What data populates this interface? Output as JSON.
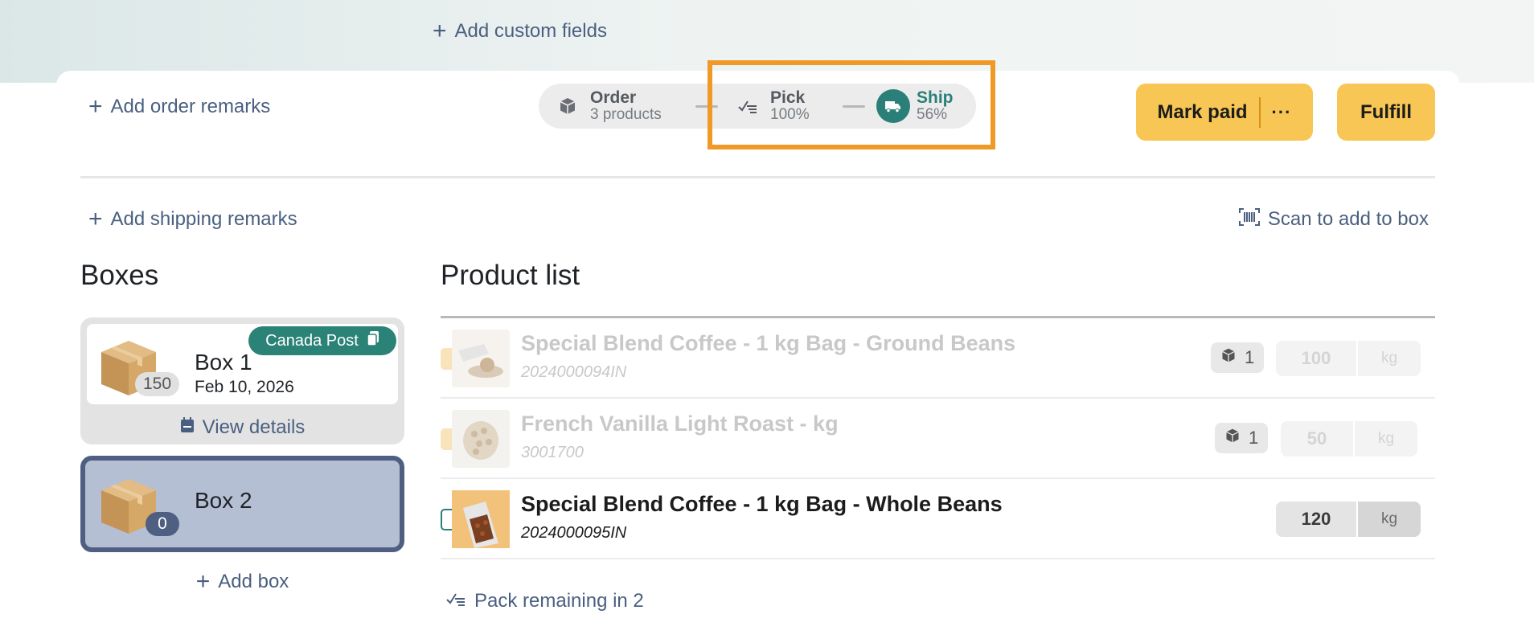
{
  "header": {
    "add_custom_fields": "Add custom fields",
    "add_order_remarks": "Add order remarks"
  },
  "progress": {
    "order": {
      "label": "Order",
      "sub": "3 products"
    },
    "pick": {
      "label": "Pick",
      "sub": "100%"
    },
    "ship": {
      "label": "Ship",
      "sub": "56%"
    }
  },
  "actions": {
    "mark_paid": "Mark paid",
    "more": "···",
    "fulfill": "Fulfill"
  },
  "shipping": {
    "add_shipping_remarks": "Add shipping remarks",
    "scan_to_add": "Scan to add to box"
  },
  "boxes": {
    "heading": "Boxes",
    "items": [
      {
        "title": "Box 1",
        "count": "150",
        "date": "Feb 10, 2026",
        "carrier": "Canada Post",
        "view_details": "View details"
      },
      {
        "title": "Box 2",
        "count": "0"
      }
    ],
    "add_box": "Add box"
  },
  "products": {
    "heading": "Product list",
    "items": [
      {
        "name": "Special Blend Coffee - 1 kg Bag - Ground Beans",
        "sku": "2024000094IN",
        "box_count": "1",
        "qty": "100",
        "unit": "kg",
        "status": "done"
      },
      {
        "name": "French Vanilla Light Roast - kg",
        "sku": "3001700",
        "box_count": "1",
        "qty": "50",
        "unit": "kg",
        "status": "done"
      },
      {
        "name": "Special Blend Coffee - 1 kg Bag - Whole Beans",
        "sku": "2024000095IN",
        "qty": "120",
        "unit": "kg",
        "status": "pending"
      }
    ],
    "pack_remaining": "Pack remaining in 2"
  },
  "colors": {
    "accent_teal": "#2a8078",
    "button_yellow": "#f7c654",
    "highlight_orange": "#ef9a27",
    "link_blue": "#4a5f80",
    "selected_box": "#b5bfd4"
  }
}
